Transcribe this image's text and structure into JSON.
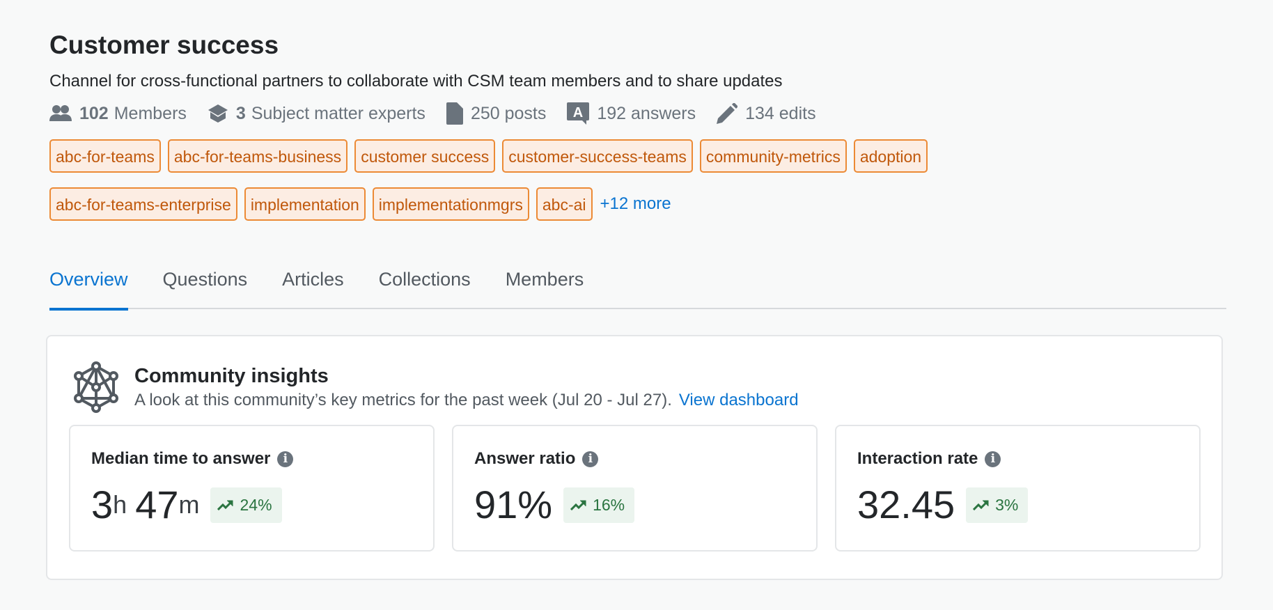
{
  "header": {
    "title": "Customer success",
    "description": "Channel for cross-functional partners to collaborate with CSM team members and to share updates"
  },
  "stats": [
    {
      "icon": "members-icon",
      "count": "102",
      "label": "Members"
    },
    {
      "icon": "graduation-cap-icon",
      "count": "3",
      "label": "Subject matter experts"
    },
    {
      "icon": "document-icon",
      "count": "",
      "label": "250 posts"
    },
    {
      "icon": "answer-icon",
      "count": "",
      "label": "192 answers"
    },
    {
      "icon": "pencil-icon",
      "count": "",
      "label": "134 edits"
    }
  ],
  "tags": [
    "abc-for-teams",
    "abc-for-teams-business",
    "customer success",
    "customer-success-teams",
    "community-metrics",
    "adoption",
    "abc-for-teams-enterprise",
    "implementation",
    "implementationmgrs",
    "abc-ai"
  ],
  "more_tags": "+12 more",
  "tabs": [
    {
      "label": "Overview",
      "active": true
    },
    {
      "label": "Questions",
      "active": false
    },
    {
      "label": "Articles",
      "active": false
    },
    {
      "label": "Collections",
      "active": false
    },
    {
      "label": "Members",
      "active": false
    }
  ],
  "insights": {
    "title": "Community insights",
    "subtitle": "A look at this community’s key metrics for the past week (Jul 20 - Jul 27).",
    "link": "View dashboard",
    "metrics": [
      {
        "label": "Median time to answer",
        "value_parts": [
          "3",
          "h",
          "47",
          "m"
        ],
        "trend": "24%"
      },
      {
        "label": "Answer ratio",
        "value": "91%",
        "trend": "16%"
      },
      {
        "label": "Interaction rate",
        "value": "32.45",
        "trend": "3%"
      }
    ]
  },
  "colors": {
    "accent": "#0a74d0",
    "tag_text": "#c0580b",
    "tag_bg": "#fcede3",
    "tag_border": "#ec8a35",
    "trend_text": "#2a7440",
    "trend_bg": "#ebf4ee"
  }
}
